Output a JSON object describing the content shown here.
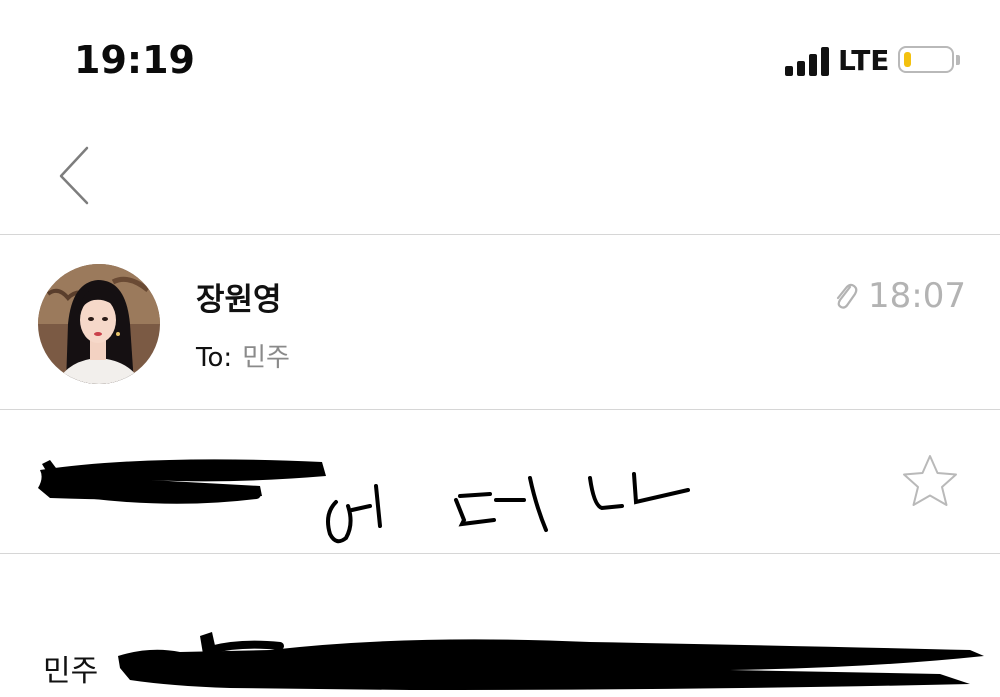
{
  "status_bar": {
    "time": "19:19",
    "network": "LTE",
    "battery_level_fraction": 0.15,
    "battery_color": "#f3c10f"
  },
  "nav": {
    "back_icon": "chevron-left-icon"
  },
  "message": {
    "sender_name": "장원영",
    "to_label": "To:",
    "recipient": "민주",
    "received_time": "18:07",
    "has_attachment": true,
    "subject_visible_text": "어머나",
    "starred": false,
    "body_visible_start": "민주"
  }
}
